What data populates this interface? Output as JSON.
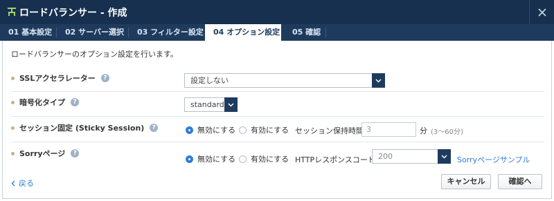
{
  "window": {
    "title": "ロードバランサー - 作成"
  },
  "tabs": [
    {
      "label": "01 基本設定"
    },
    {
      "label": "02 サーバー選択"
    },
    {
      "label": "03 フィルター設定"
    },
    {
      "label": "04 オプション設定"
    },
    {
      "label": "05 確認"
    }
  ],
  "intro": "ロードバランサーのオプション設定を行います。",
  "ssl": {
    "label": "SSLアクセラレーター",
    "value": "設定しない"
  },
  "encryption": {
    "label": "暗号化タイプ",
    "value": "standard"
  },
  "session": {
    "label": "セッション固定 (Sticky Session)",
    "disable": "無効にする",
    "enable": "有効にする",
    "time_label": "セッション保持時間",
    "time_value": "3",
    "unit": "分",
    "range": "(3〜60分)"
  },
  "sorry": {
    "label": "Sorryページ",
    "disable": "無効にする",
    "enable": "有効にする",
    "code_label": "HTTPレスポンスコード",
    "code_value": "200",
    "sample_link": "Sorryページサンプル"
  },
  "footer": {
    "back": "戻る",
    "cancel": "キャンセル",
    "confirm": "確認へ"
  },
  "colors": {
    "header": "#17304f",
    "tabbar": "#1e3b5e",
    "accent": "#2f7ed8"
  }
}
